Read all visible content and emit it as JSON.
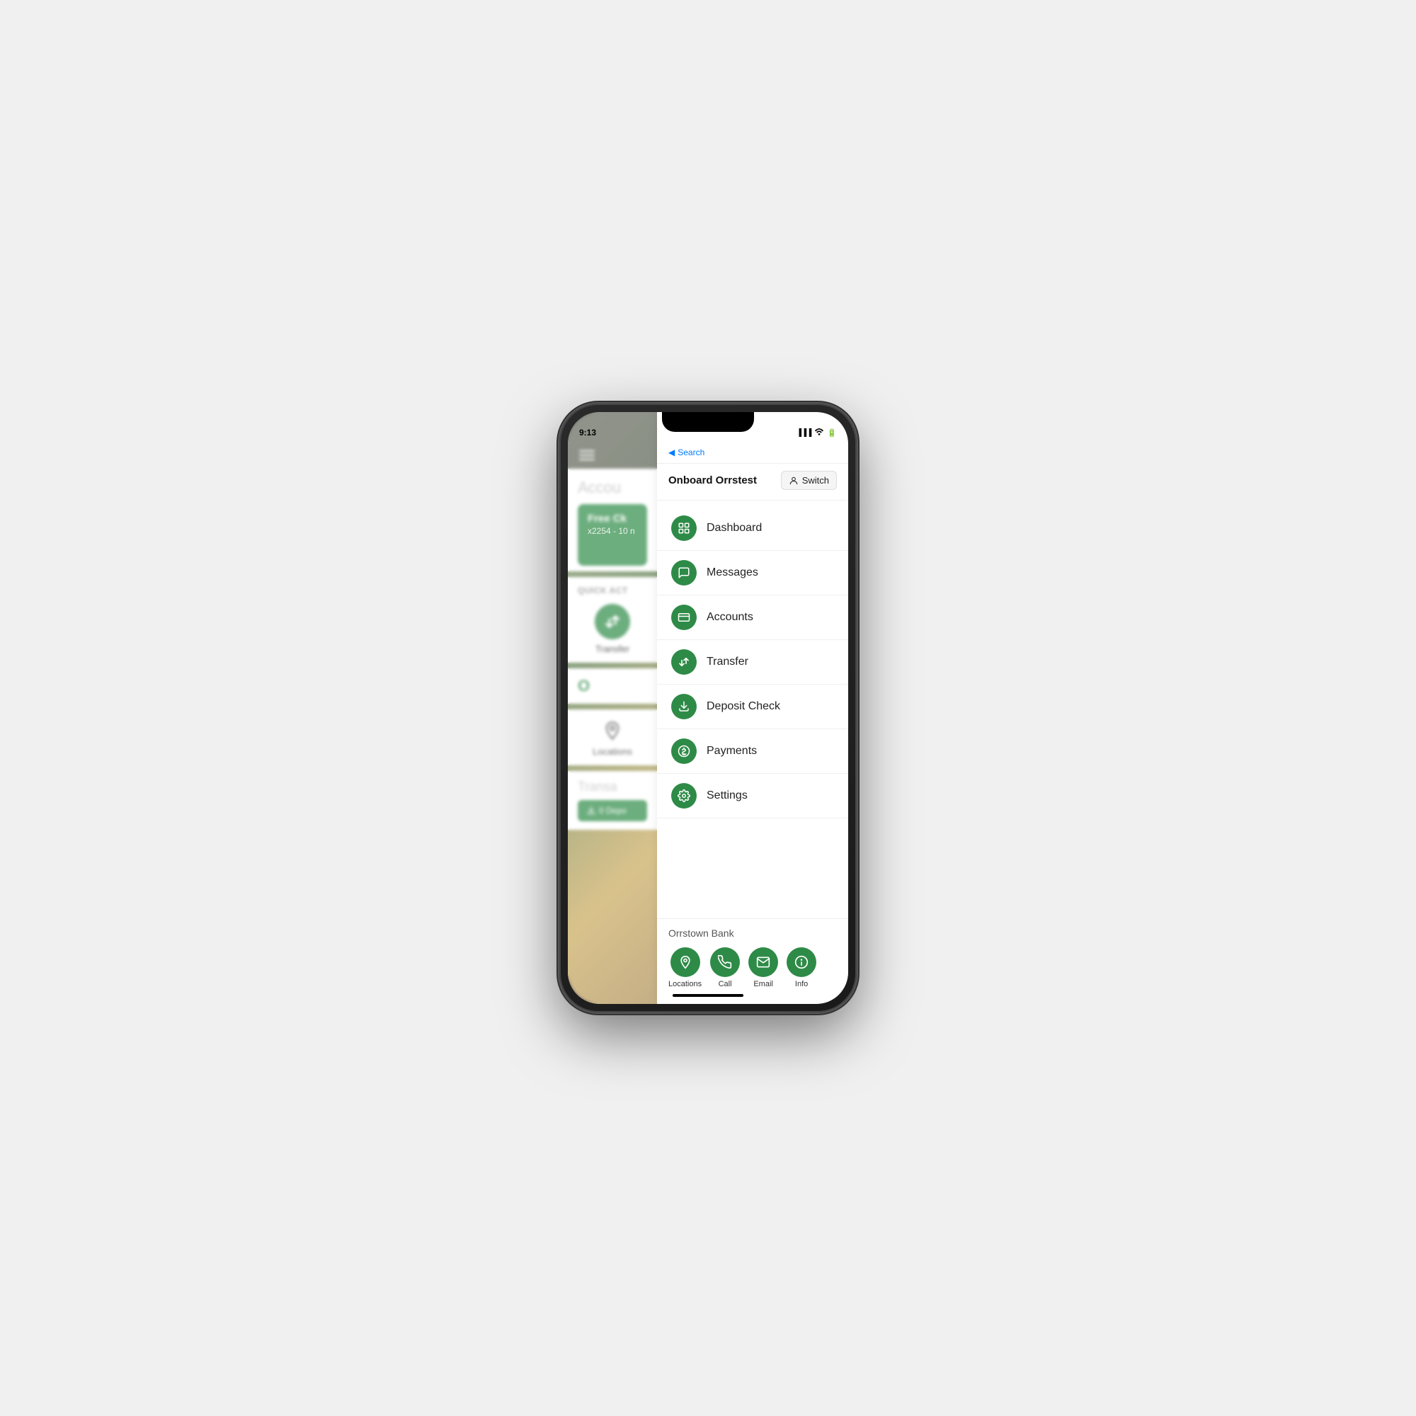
{
  "phone": {
    "status_time": "9:13",
    "status_signal": "▐▐▐",
    "status_wifi": "wifi",
    "status_battery": "🔋"
  },
  "sidebar": {
    "search_placeholder": "Search",
    "account_name": "Onboard Orrstest",
    "switch_label": "Switch",
    "nav_items": [
      {
        "id": "dashboard",
        "label": "Dashboard",
        "icon": "⊞"
      },
      {
        "id": "messages",
        "label": "Messages",
        "icon": "💬"
      },
      {
        "id": "accounts",
        "label": "Accounts",
        "icon": "🏦"
      },
      {
        "id": "transfer",
        "label": "Transfer",
        "icon": "🔄"
      },
      {
        "id": "deposit-check",
        "label": "Deposit Check",
        "icon": "📥"
      },
      {
        "id": "payments",
        "label": "Payments",
        "icon": "💰"
      },
      {
        "id": "settings",
        "label": "Settings",
        "icon": "⚙"
      }
    ],
    "bank_section": {
      "name": "Orrstown Bank",
      "actions": [
        {
          "id": "locations",
          "label": "Locations",
          "icon": "📍"
        },
        {
          "id": "call",
          "label": "Call",
          "icon": "📞"
        },
        {
          "id": "email",
          "label": "Email",
          "icon": "✉"
        },
        {
          "id": "info",
          "label": "Info",
          "icon": "ℹ"
        }
      ]
    }
  },
  "right_panel": {
    "accounts_title": "Accou",
    "account_card": {
      "name": "Free Ck",
      "sub": "x2254 - 10 n"
    },
    "quick_actions_title": "QUICK ACT",
    "quick_transfer": {
      "label": "Transfer",
      "icon": "🔄"
    },
    "other_item": "O",
    "locations": {
      "label": "Locations",
      "icon": "📍"
    },
    "transactions_title": "Transa",
    "deposit_filter": "0 Depo"
  }
}
